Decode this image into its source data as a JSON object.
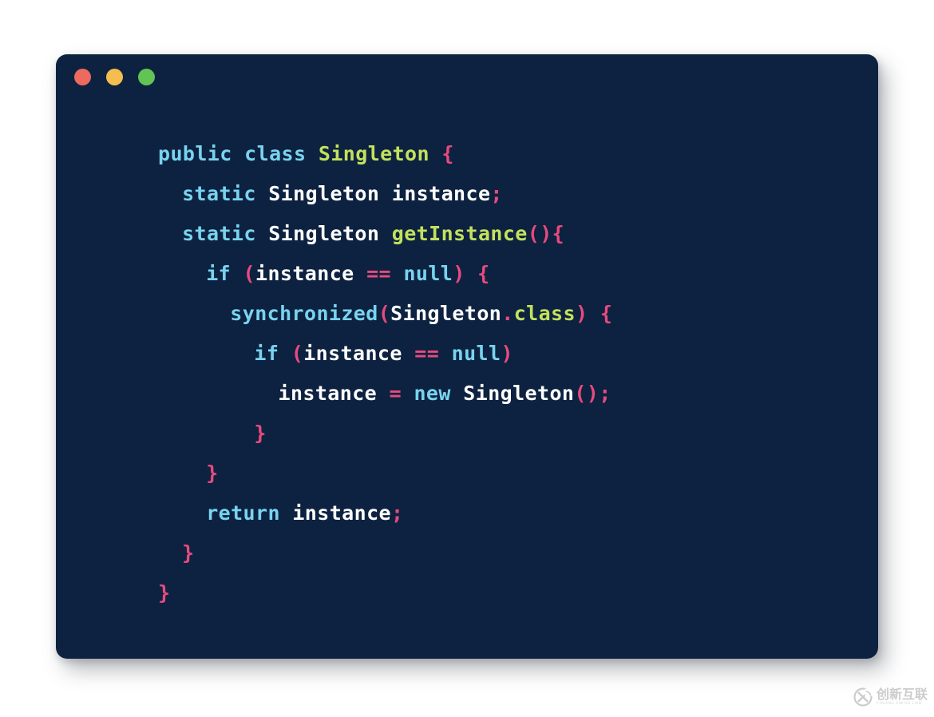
{
  "window": {
    "background_color": "#0d2240",
    "page_background": "#ffffff",
    "controls": [
      {
        "name": "close",
        "color": "#ec6a5e"
      },
      {
        "name": "minimize",
        "color": "#f4bd4f"
      },
      {
        "name": "maximize",
        "color": "#61c454"
      }
    ]
  },
  "theme": {
    "keyword": "#79d3ef",
    "identifier": "#ffffff",
    "declaration": "#c3e15c",
    "punctuation": "#e84a7f",
    "operator": "#e84a7f"
  },
  "code": {
    "language": "java",
    "plain_text": "public class Singleton {\n  static Singleton instance;\n  static Singleton getInstance(){\n    if (instance == null) {\n      synchronized(Singleton.class) {\n        if (instance == null)\n          instance = new Singleton();\n        }\n    }\n    return instance;\n  }\n}",
    "lines": [
      {
        "indent": 0,
        "tokens": [
          {
            "t": "public",
            "c": "keyword"
          },
          {
            "t": " ",
            "c": "plain"
          },
          {
            "t": "class",
            "c": "keyword"
          },
          {
            "t": " ",
            "c": "plain"
          },
          {
            "t": "Singleton",
            "c": "declaration"
          },
          {
            "t": " ",
            "c": "plain"
          },
          {
            "t": "{",
            "c": "punctuation"
          }
        ]
      },
      {
        "indent": 1,
        "tokens": [
          {
            "t": "static",
            "c": "keyword"
          },
          {
            "t": " ",
            "c": "plain"
          },
          {
            "t": "Singleton",
            "c": "identifier"
          },
          {
            "t": " ",
            "c": "plain"
          },
          {
            "t": "instance",
            "c": "identifier"
          },
          {
            "t": ";",
            "c": "punctuation"
          }
        ]
      },
      {
        "indent": 1,
        "tokens": [
          {
            "t": "static",
            "c": "keyword"
          },
          {
            "t": " ",
            "c": "plain"
          },
          {
            "t": "Singleton",
            "c": "identifier"
          },
          {
            "t": " ",
            "c": "plain"
          },
          {
            "t": "getInstance",
            "c": "declaration"
          },
          {
            "t": "(){",
            "c": "punctuation"
          }
        ]
      },
      {
        "indent": 2,
        "tokens": [
          {
            "t": "if",
            "c": "keyword"
          },
          {
            "t": " ",
            "c": "plain"
          },
          {
            "t": "(",
            "c": "punctuation"
          },
          {
            "t": "instance",
            "c": "identifier"
          },
          {
            "t": " ",
            "c": "plain"
          },
          {
            "t": "==",
            "c": "operator"
          },
          {
            "t": " ",
            "c": "plain"
          },
          {
            "t": "null",
            "c": "keyword"
          },
          {
            "t": ")",
            "c": "punctuation"
          },
          {
            "t": " ",
            "c": "plain"
          },
          {
            "t": "{",
            "c": "punctuation"
          }
        ]
      },
      {
        "indent": 3,
        "tokens": [
          {
            "t": "synchronized",
            "c": "keyword"
          },
          {
            "t": "(",
            "c": "punctuation"
          },
          {
            "t": "Singleton",
            "c": "identifier"
          },
          {
            "t": ".",
            "c": "punctuation"
          },
          {
            "t": "class",
            "c": "declaration"
          },
          {
            "t": ")",
            "c": "punctuation"
          },
          {
            "t": " ",
            "c": "plain"
          },
          {
            "t": "{",
            "c": "punctuation"
          }
        ]
      },
      {
        "indent": 4,
        "tokens": [
          {
            "t": "if",
            "c": "keyword"
          },
          {
            "t": " ",
            "c": "plain"
          },
          {
            "t": "(",
            "c": "punctuation"
          },
          {
            "t": "instance",
            "c": "identifier"
          },
          {
            "t": " ",
            "c": "plain"
          },
          {
            "t": "==",
            "c": "operator"
          },
          {
            "t": " ",
            "c": "plain"
          },
          {
            "t": "null",
            "c": "keyword"
          },
          {
            "t": ")",
            "c": "punctuation"
          }
        ]
      },
      {
        "indent": 5,
        "tokens": [
          {
            "t": "instance",
            "c": "identifier"
          },
          {
            "t": " ",
            "c": "plain"
          },
          {
            "t": "=",
            "c": "operator"
          },
          {
            "t": " ",
            "c": "plain"
          },
          {
            "t": "new",
            "c": "keyword"
          },
          {
            "t": " ",
            "c": "plain"
          },
          {
            "t": "Singleton",
            "c": "identifier"
          },
          {
            "t": "();",
            "c": "punctuation"
          }
        ]
      },
      {
        "indent": 4,
        "tokens": [
          {
            "t": "}",
            "c": "punctuation"
          }
        ]
      },
      {
        "indent": 2,
        "tokens": [
          {
            "t": "}",
            "c": "punctuation"
          }
        ]
      },
      {
        "indent": 2,
        "tokens": [
          {
            "t": "return",
            "c": "keyword"
          },
          {
            "t": " ",
            "c": "plain"
          },
          {
            "t": "instance",
            "c": "identifier"
          },
          {
            "t": ";",
            "c": "punctuation"
          }
        ]
      },
      {
        "indent": 1,
        "tokens": [
          {
            "t": "}",
            "c": "punctuation"
          }
        ]
      },
      {
        "indent": 0,
        "tokens": [
          {
            "t": "}",
            "c": "punctuation"
          }
        ]
      }
    ]
  },
  "watermark": {
    "chinese": "创新互联",
    "pinyin": "CHUANG XIN HU LIAN",
    "logo_letter": "X",
    "color": "#a8a8a8"
  }
}
